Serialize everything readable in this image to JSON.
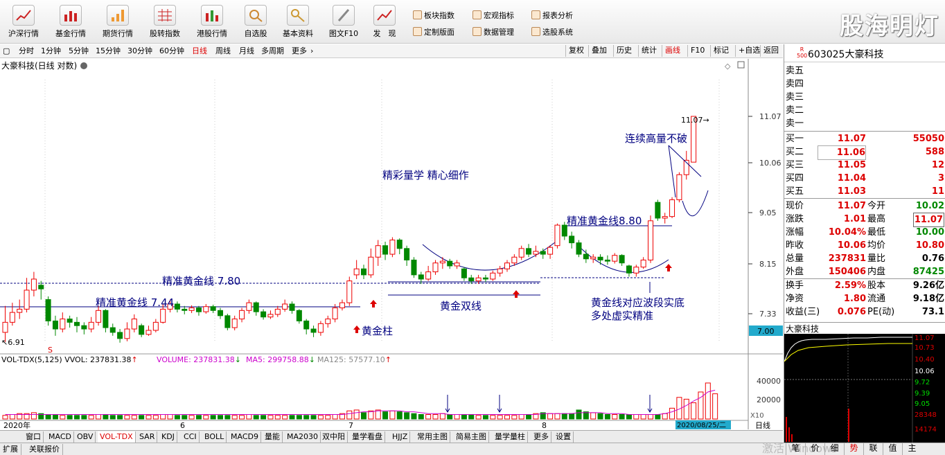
{
  "toolbar": {
    "buttons": [
      "沪深行情",
      "基金行情",
      "期货行情",
      "股转指数",
      "港股行情",
      "自选股",
      "基本资料",
      "图文F10",
      "发　现"
    ],
    "links": [
      "板块指数",
      "宏观指标",
      "报表分析",
      "定制版面",
      "数据管理",
      "选股系统"
    ],
    "brand": "股海明灯"
  },
  "periods": [
    "分时",
    "1分钟",
    "5分钟",
    "15分钟",
    "30分钟",
    "60分钟",
    "日线",
    "周线",
    "月线",
    "多周期",
    "更多"
  ],
  "active_period": "日线",
  "right_tools": [
    "复权",
    "叠加",
    "历史",
    "统计",
    "画线",
    "F10",
    "标记",
    "+自选",
    "返回"
  ],
  "active_tool": "画线",
  "chart": {
    "title": "大豪科技(日线 对数)",
    "price_ticks": [
      "11.07",
      "10.06",
      "9.05",
      "8.15",
      "7.33"
    ],
    "current_price_tag": "7.00",
    "low_label": "6.91",
    "high_label": "11.07",
    "date_start": "2020年",
    "month_labels": [
      "6",
      "7",
      "8"
    ],
    "cursor_date": "2020/08/25/二",
    "annotations": {
      "gold_line_1": "精准黄金线 7.44",
      "gold_line_2": "精准黄金线  7.80",
      "gold_line_3": "精准黄金线8.80",
      "gold_pillar": "黄金柱",
      "gold_double": "黄金双线",
      "slogan": "精彩量学 精心细作",
      "high_volume": "连续高量不破",
      "support_line1": "黄金线对应波段实底",
      "support_line2": "多处虚实精准"
    },
    "candles": [
      {
        "o": 7.05,
        "c": 7.2,
        "h": 7.45,
        "l": 6.91
      },
      {
        "o": 7.2,
        "c": 7.35,
        "h": 7.5,
        "l": 7.15
      },
      {
        "o": 7.35,
        "c": 7.4,
        "h": 7.55,
        "l": 7.25
      },
      {
        "o": 7.4,
        "c": 7.7,
        "h": 7.9,
        "l": 7.35
      },
      {
        "o": 7.7,
        "c": 7.88,
        "h": 8.0,
        "l": 7.6
      },
      {
        "o": 7.78,
        "c": 7.72,
        "h": 7.85,
        "l": 7.55
      },
      {
        "o": 7.55,
        "c": 7.22,
        "h": 7.6,
        "l": 7.15
      },
      {
        "o": 7.22,
        "c": 7.1,
        "h": 7.3,
        "l": 7.0
      },
      {
        "o": 7.1,
        "c": 7.25,
        "h": 7.35,
        "l": 7.05
      },
      {
        "o": 7.25,
        "c": 7.2,
        "h": 7.3,
        "l": 7.12
      },
      {
        "o": 7.2,
        "c": 7.15,
        "h": 7.28,
        "l": 7.05
      },
      {
        "o": 7.15,
        "c": 7.1,
        "h": 7.2,
        "l": 7.02
      },
      {
        "o": 7.1,
        "c": 7.2,
        "h": 7.28,
        "l": 7.05
      },
      {
        "o": 7.2,
        "c": 7.38,
        "h": 7.45,
        "l": 7.15
      },
      {
        "o": 7.38,
        "c": 7.12,
        "h": 7.4,
        "l": 7.05
      },
      {
        "o": 7.12,
        "c": 7.05,
        "h": 7.18,
        "l": 7.0
      },
      {
        "o": 7.05,
        "c": 6.96,
        "h": 7.1,
        "l": 6.9
      },
      {
        "o": 6.96,
        "c": 7.1,
        "h": 7.2,
        "l": 6.92
      },
      {
        "o": 7.1,
        "c": 7.25,
        "h": 7.32,
        "l": 7.05
      },
      {
        "o": 7.15,
        "c": 7.02,
        "h": 7.18,
        "l": 6.98
      },
      {
        "o": 7.02,
        "c": 7.08,
        "h": 7.15,
        "l": 7.0
      },
      {
        "o": 7.08,
        "c": 7.2,
        "h": 7.25,
        "l": 7.05
      },
      {
        "o": 7.2,
        "c": 7.4,
        "h": 7.48,
        "l": 7.18
      },
      {
        "o": 7.4,
        "c": 7.48,
        "h": 7.55,
        "l": 7.35
      },
      {
        "o": 7.48,
        "c": 7.4,
        "h": 7.52,
        "l": 7.35
      },
      {
        "o": 7.4,
        "c": 7.38,
        "h": 7.45,
        "l": 7.32
      },
      {
        "o": 7.38,
        "c": 7.42,
        "h": 7.46,
        "l": 7.34
      },
      {
        "o": 7.42,
        "c": 7.36,
        "h": 7.45,
        "l": 7.3
      },
      {
        "o": 7.36,
        "c": 7.44,
        "h": 7.48,
        "l": 7.33
      },
      {
        "o": 7.44,
        "c": 7.38,
        "h": 7.47,
        "l": 7.34
      },
      {
        "o": 7.38,
        "c": 7.3,
        "h": 7.42,
        "l": 7.25
      },
      {
        "o": 7.3,
        "c": 7.12,
        "h": 7.33,
        "l": 7.08
      },
      {
        "o": 7.12,
        "c": 7.25,
        "h": 7.3,
        "l": 7.08
      },
      {
        "o": 7.25,
        "c": 7.38,
        "h": 7.42,
        "l": 7.2
      },
      {
        "o": 7.38,
        "c": 7.5,
        "h": 7.55,
        "l": 7.33
      },
      {
        "o": 7.5,
        "c": 7.36,
        "h": 7.52,
        "l": 7.3
      },
      {
        "o": 7.36,
        "c": 7.28,
        "h": 7.4,
        "l": 7.24
      },
      {
        "o": 7.28,
        "c": 7.32,
        "h": 7.38,
        "l": 7.25
      },
      {
        "o": 7.32,
        "c": 7.4,
        "h": 7.45,
        "l": 7.28
      },
      {
        "o": 7.4,
        "c": 7.48,
        "h": 7.55,
        "l": 7.36
      },
      {
        "o": 7.48,
        "c": 7.38,
        "h": 7.52,
        "l": 7.33
      },
      {
        "o": 7.38,
        "c": 7.22,
        "h": 7.4,
        "l": 7.18
      },
      {
        "o": 7.22,
        "c": 7.1,
        "h": 7.25,
        "l": 7.02
      },
      {
        "o": 7.1,
        "c": 7.05,
        "h": 7.15,
        "l": 6.98
      },
      {
        "o": 7.05,
        "c": 7.18,
        "h": 7.22,
        "l": 7.0
      },
      {
        "o": 7.18,
        "c": 7.25,
        "h": 7.3,
        "l": 7.12
      },
      {
        "o": 7.25,
        "c": 7.42,
        "h": 7.48,
        "l": 7.2
      },
      {
        "o": 7.42,
        "c": 7.5,
        "h": 7.55,
        "l": 7.38
      },
      {
        "o": 7.5,
        "c": 7.85,
        "h": 7.92,
        "l": 7.45
      },
      {
        "o": 7.95,
        "c": 8.05,
        "h": 8.2,
        "l": 7.88
      },
      {
        "o": 8.05,
        "c": 7.95,
        "h": 8.12,
        "l": 7.88
      },
      {
        "o": 7.95,
        "c": 8.25,
        "h": 8.4,
        "l": 7.9
      },
      {
        "o": 8.25,
        "c": 8.45,
        "h": 8.55,
        "l": 8.1
      },
      {
        "o": 8.45,
        "c": 8.3,
        "h": 8.52,
        "l": 8.2
      },
      {
        "o": 8.3,
        "c": 8.55,
        "h": 8.6,
        "l": 8.25
      },
      {
        "o": 8.55,
        "c": 8.4,
        "h": 8.58,
        "l": 8.3
      },
      {
        "o": 8.4,
        "c": 8.2,
        "h": 8.45,
        "l": 8.1
      },
      {
        "o": 8.2,
        "c": 7.95,
        "h": 8.25,
        "l": 7.9
      },
      {
        "o": 7.95,
        "c": 7.88,
        "h": 8.0,
        "l": 7.8
      },
      {
        "o": 7.88,
        "c": 8.0,
        "h": 8.1,
        "l": 7.85
      },
      {
        "o": 8.0,
        "c": 8.15,
        "h": 8.2,
        "l": 7.95
      },
      {
        "o": 8.15,
        "c": 8.18,
        "h": 8.25,
        "l": 8.05
      },
      {
        "o": 8.18,
        "c": 8.1,
        "h": 8.22,
        "l": 8.05
      },
      {
        "o": 8.1,
        "c": 8.15,
        "h": 8.2,
        "l": 8.05
      },
      {
        "o": 8.05,
        "c": 7.9,
        "h": 8.08,
        "l": 7.85
      },
      {
        "o": 7.9,
        "c": 7.85,
        "h": 7.95,
        "l": 7.8
      },
      {
        "o": 7.85,
        "c": 7.9,
        "h": 7.95,
        "l": 7.8
      },
      {
        "o": 7.9,
        "c": 7.88,
        "h": 7.95,
        "l": 7.83
      },
      {
        "o": 7.88,
        "c": 7.98,
        "h": 8.02,
        "l": 7.85
      },
      {
        "o": 7.98,
        "c": 8.05,
        "h": 8.1,
        "l": 7.92
      },
      {
        "o": 8.05,
        "c": 8.15,
        "h": 8.2,
        "l": 8.0
      },
      {
        "o": 8.15,
        "c": 8.25,
        "h": 8.3,
        "l": 8.1
      },
      {
        "o": 8.25,
        "c": 8.4,
        "h": 8.45,
        "l": 8.2
      },
      {
        "o": 8.4,
        "c": 8.3,
        "h": 8.48,
        "l": 8.25
      },
      {
        "o": 8.3,
        "c": 8.35,
        "h": 8.45,
        "l": 8.25
      },
      {
        "o": 8.35,
        "c": 8.3,
        "h": 8.4,
        "l": 8.22
      },
      {
        "o": 8.3,
        "c": 8.42,
        "h": 8.46,
        "l": 8.22
      },
      {
        "o": 8.45,
        "c": 8.82,
        "h": 8.85,
        "l": 8.4
      },
      {
        "o": 8.82,
        "c": 8.62,
        "h": 8.88,
        "l": 8.55
      },
      {
        "o": 8.62,
        "c": 8.5,
        "h": 8.7,
        "l": 8.4
      },
      {
        "o": 8.5,
        "c": 8.3,
        "h": 8.55,
        "l": 8.25
      },
      {
        "o": 8.3,
        "c": 8.22,
        "h": 8.38,
        "l": 8.15
      },
      {
        "o": 8.22,
        "c": 8.25,
        "h": 8.3,
        "l": 8.15
      },
      {
        "o": 8.25,
        "c": 8.2,
        "h": 8.3,
        "l": 8.12
      },
      {
        "o": 8.2,
        "c": 8.18,
        "h": 8.28,
        "l": 8.12
      },
      {
        "o": 8.18,
        "c": 8.28,
        "h": 8.32,
        "l": 8.14
      },
      {
        "o": 8.28,
        "c": 8.15,
        "h": 8.3,
        "l": 8.1
      },
      {
        "o": 8.1,
        "c": 7.98,
        "h": 8.12,
        "l": 7.92
      },
      {
        "o": 7.98,
        "c": 8.08,
        "h": 8.12,
        "l": 7.92
      },
      {
        "o": 8.08,
        "c": 8.2,
        "h": 8.25,
        "l": 8.05
      },
      {
        "o": 8.2,
        "c": 8.9,
        "h": 9.0,
        "l": 8.15
      },
      {
        "o": 9.25,
        "c": 8.95,
        "h": 9.3,
        "l": 8.9
      },
      {
        "o": 8.95,
        "c": 8.98,
        "h": 9.05,
        "l": 8.85
      },
      {
        "o": 8.98,
        "c": 9.3,
        "h": 9.35,
        "l": 8.95
      },
      {
        "o": 9.3,
        "c": 9.8,
        "h": 9.85,
        "l": 9.25
      },
      {
        "o": 9.8,
        "c": 10.1,
        "h": 10.3,
        "l": 9.7
      },
      {
        "o": 10.06,
        "c": 11.07,
        "h": 11.07,
        "l": 10.06
      }
    ]
  },
  "volume_panel": {
    "title": "VOL-TDX(5,125)",
    "vvol": "VVOL: 237831.38",
    "volume": "VOLUME: 237831.38",
    "ma5": "MA5: 299758.88",
    "ma125": "MA125: 57577.10",
    "ticks": [
      "40000",
      "20000"
    ],
    "unit": "X10",
    "values": [
      4,
      5,
      6,
      6,
      7,
      6,
      5,
      5,
      4,
      4,
      4,
      4,
      4,
      5,
      5,
      4,
      4,
      4,
      4,
      4,
      4,
      4,
      5,
      5,
      4,
      4,
      4,
      4,
      4,
      4,
      4,
      4,
      4,
      4,
      5,
      4,
      4,
      4,
      4,
      4,
      4,
      4,
      4,
      4,
      4,
      4,
      5,
      6,
      9,
      10,
      7,
      9,
      10,
      8,
      9,
      8,
      7,
      6,
      5,
      5,
      5,
      6,
      5,
      5,
      5,
      5,
      4,
      4,
      4,
      4,
      4,
      4,
      5,
      5,
      6,
      7,
      6,
      6,
      6,
      6,
      10,
      8,
      7,
      6,
      5,
      5,
      5,
      5,
      5,
      5,
      5,
      5,
      6,
      12,
      24,
      22,
      18,
      30,
      40,
      28
    ],
    "ma_values": [
      5,
      5,
      5,
      5,
      5,
      5,
      5,
      5,
      5,
      5,
      5,
      5,
      5,
      5,
      5,
      5,
      5,
      5,
      5,
      5,
      5,
      5,
      5,
      5,
      5,
      5,
      5,
      5,
      5,
      5,
      5,
      5,
      5,
      5,
      5,
      5,
      5,
      5,
      5,
      5,
      5,
      5,
      5,
      5,
      5,
      5,
      5,
      5,
      6,
      7,
      8,
      8,
      9,
      9,
      9,
      9,
      8,
      8,
      7,
      6,
      6,
      6,
      5,
      5,
      5,
      5,
      5,
      5,
      5,
      5,
      5,
      5,
      5,
      5,
      5,
      6,
      6,
      6,
      6,
      6,
      7,
      7,
      7,
      7,
      6,
      6,
      6,
      5,
      5,
      5,
      5,
      5,
      6,
      8,
      11,
      15,
      20,
      24,
      30,
      32
    ]
  },
  "tabs": [
    "窗口",
    "MACD",
    "OBV",
    "VOL-TDX",
    "SAR",
    "KDJ",
    "CCI",
    "BOLL",
    "MACD9",
    "量能",
    "MA2030",
    "双中阳",
    "量学看盘",
    "HJJZ",
    "常用主图",
    "简易主图",
    "量学量柱",
    "更多",
    "设置"
  ],
  "active_tab": "VOL-TDX",
  "statusbar": [
    "扩展",
    "关联报价"
  ],
  "right_foot": [
    "笔",
    "价",
    "细",
    "势",
    "联",
    "值",
    "主"
  ],
  "watermark": "激活 Windows",
  "quote": {
    "r_badge": "R\n500",
    "code": "603025",
    "name": "大豪科技",
    "sell": [
      {
        "label": "卖五",
        "price": "",
        "vol": ""
      },
      {
        "label": "卖四",
        "price": "",
        "vol": ""
      },
      {
        "label": "卖三",
        "price": "",
        "vol": ""
      },
      {
        "label": "卖二",
        "price": "",
        "vol": ""
      },
      {
        "label": "卖一",
        "price": "",
        "vol": ""
      }
    ],
    "buy": [
      {
        "label": "买一",
        "price": "11.07",
        "vol": "55050"
      },
      {
        "label": "买二",
        "price": "11.06",
        "vol": "588"
      },
      {
        "label": "买三",
        "price": "11.05",
        "vol": "12"
      },
      {
        "label": "买四",
        "price": "11.04",
        "vol": "3"
      },
      {
        "label": "买五",
        "price": "11.03",
        "vol": "11"
      }
    ],
    "stats": [
      {
        "l1": "现价",
        "v1": "11.07",
        "c1": "red",
        "l2": "今开",
        "v2": "10.02",
        "c2": "green"
      },
      {
        "l1": "涨跌",
        "v1": "1.01",
        "c1": "red",
        "l2": "最高",
        "v2": "11.07",
        "c2": "red"
      },
      {
        "l1": "涨幅",
        "v1": "10.04%",
        "c1": "red",
        "l2": "最低",
        "v2": "10.00",
        "c2": "green"
      },
      {
        "l1": "昨收",
        "v1": "10.06",
        "c1": "dark",
        "l2": "均价",
        "v2": "10.80",
        "c2": "red"
      },
      {
        "l1": "总量",
        "v1": "237831",
        "c1": "red",
        "l2": "量比",
        "v2": "0.76",
        "c2": "dark"
      },
      {
        "l1": "外盘",
        "v1": "150406",
        "c1": "red",
        "l2": "内盘",
        "v2": "87425",
        "c2": "green"
      }
    ],
    "stats2": [
      {
        "l1": "换手",
        "v1": "2.59%",
        "l2": "股本",
        "v2": "9.26亿"
      },
      {
        "l1": "净资",
        "v1": "1.80",
        "l2": "流通",
        "v2": "9.18亿"
      },
      {
        "l1": "收益(三)",
        "v1": "0.076",
        "l2": "PE(动)",
        "v2": "73.1"
      }
    ],
    "mini_title": "大豪科技",
    "mini_ticks": [
      "11.07",
      "10.73",
      "10.40",
      "10.06",
      "9.72",
      "9.39",
      "9.05"
    ],
    "mini_vol_ticks": [
      "28348",
      "14174"
    ]
  }
}
